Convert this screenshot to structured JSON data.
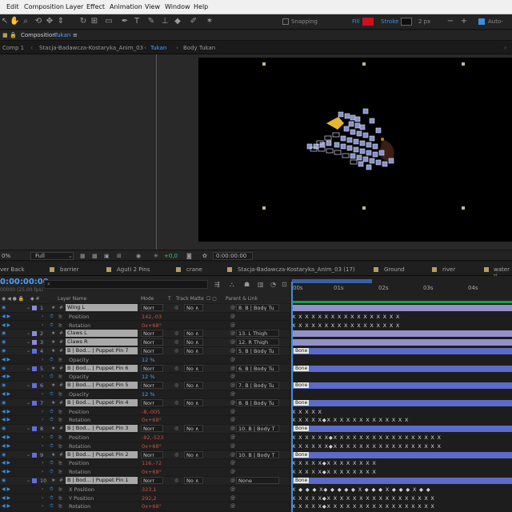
{
  "menu": [
    "Edit",
    "Composition",
    "Layer",
    "Effect",
    "Animation",
    "View",
    "Window",
    "Help"
  ],
  "toolbar": {
    "snapping": "Snapping",
    "fill": "Fill",
    "stroke": "Stroke",
    "stroke_width": "2 px",
    "auto": "Auto-",
    "fill_color": "#d1101f",
    "stroke_color": "#0e0e0e"
  },
  "comp_panel": {
    "prefix": "Composition",
    "name": "Tukan",
    "menu_glyph": "≡"
  },
  "breadcrumbs": [
    "Comp 1",
    "Stacja-Badawcza-Kostaryka_Anim_03",
    "Tukan",
    "Body Tukan"
  ],
  "viewer_footer": {
    "zoom": "0%",
    "resolution": "Full",
    "exposure": "+0,0",
    "timecode": "0:00:00:00"
  },
  "timeline_tabs": [
    "ver Back",
    "barrier",
    "Aguti 2 Pins",
    "crane",
    "Stacja-Badawcza-Kostaryka_Anim_03 (17)",
    "Ground",
    "river",
    "water ri"
  ],
  "timeline": {
    "timecode": "0:00:00:00",
    "fps": "00000 (25.00 fps)",
    "search_placeholder": "",
    "columns": {
      "layer_name": "Layer Name",
      "mode": "Mode",
      "t": "T",
      "track_matte": "Track Matte",
      "parent": "Parent & Link"
    },
    "ruler": [
      "00s",
      "01s",
      "02s",
      "03s",
      "04s"
    ]
  },
  "rows": [
    {
      "type": "layer",
      "num": "1",
      "name": "Wing L",
      "mode": "Norr",
      "tm": "No ∧",
      "parent": "8. B | Body Tu",
      "label": "#8f8ad9",
      "bar": "#9292c8",
      "kf": ""
    },
    {
      "type": "prop",
      "name": "Position",
      "value": "142,-03",
      "kf": "X                                X  X  X  X  X            X  X X X X X X X   X X X"
    },
    {
      "type": "prop",
      "name": "Rotation",
      "value": "0x+68°",
      "kf": "X                                X  X  X  X  X            X  X X X X X X X   X X X"
    },
    {
      "type": "layer",
      "num": "2",
      "name": "Claws L",
      "mode": "Norr",
      "tm": "No ∧",
      "parent": "13. L Thigh",
      "label": "#8f8ad9",
      "bar": "#9292c8",
      "kf": ""
    },
    {
      "type": "layer",
      "num": "3",
      "name": "Claws R",
      "mode": "Norr",
      "tm": "No ∧",
      "parent": "12. R Thigh",
      "label": "#8f8ad9",
      "bar": "#9292c8",
      "kf": ""
    },
    {
      "type": "layer",
      "num": "4",
      "name": "B | Bod... | Puppet Pin 7",
      "mode": "Norr",
      "tm": "No ∧",
      "parent": "5. B | Body Tu",
      "label": "#5f6ee0",
      "bar": "#5c6ac8",
      "kf": "",
      "bone": "Bone"
    },
    {
      "type": "prop",
      "name": "Opacity",
      "value": "12 %",
      "blue": true,
      "kf": ""
    },
    {
      "type": "layer",
      "num": "5",
      "name": "B | Bod... | Puppet Pin 6",
      "mode": "Norr",
      "tm": "No ∧",
      "parent": "6. B | Body Tu",
      "label": "#5f6ee0",
      "bar": "#5c6ac8",
      "kf": "",
      "bone": "Bone"
    },
    {
      "type": "prop",
      "name": "Opacity",
      "value": "12 %",
      "blue": true,
      "kf": ""
    },
    {
      "type": "layer",
      "num": "6",
      "name": "B | Bod... | Puppet Pin 5",
      "mode": "Norr",
      "tm": "No ∧",
      "parent": "7. B | Body Tu",
      "label": "#5f6ee0",
      "bar": "#5c6ac8",
      "kf": "",
      "bone": "Bone"
    },
    {
      "type": "prop",
      "name": "Opacity",
      "value": "12 %",
      "blue": true,
      "kf": ""
    },
    {
      "type": "layer",
      "num": "7",
      "name": "B | Bod... | Puppet Pin 4",
      "mode": "Norr",
      "tm": "No ∧",
      "parent": "8. B | Body Tu",
      "label": "#5f6ee0",
      "bar": "#5c6ac8",
      "kf": "",
      "bone": "Bone"
    },
    {
      "type": "prop",
      "name": "Position",
      "value": "-8,-005",
      "kf": "X                                                                    X       X       X       X"
    },
    {
      "type": "prop",
      "name": "Rotation",
      "value": "0x+68°",
      "kf": "X   X   X   X   X◆X  X  X   X  X  X  X  X  X     X       X       X       X"
    },
    {
      "type": "layer",
      "num": "8",
      "name": "B | Bod... | Puppet Pin 3",
      "mode": "Norr",
      "tm": "No ∧",
      "parent": "10. B | Body T",
      "label": "#5f6ee0",
      "bar": "#5c6ac8",
      "kf": "",
      "bone": "Bone"
    },
    {
      "type": "prop",
      "name": "Position",
      "value": "-92,-523",
      "kf": "X  X  X  X  X  X◆X  X  X  X  X  X  X  X  X  X  X  X  X  X  X  X  X"
    },
    {
      "type": "prop",
      "name": "Rotation",
      "value": "0x+68°",
      "kf": "X  X  X  X  X  X◆X  X  X  X  X  X  X  X  X  X  X  X  X  X  X  X  X"
    },
    {
      "type": "layer",
      "num": "9",
      "name": "B | Bod... | Puppet Pin 2",
      "mode": "Norr",
      "tm": "No ∧",
      "parent": "10. B | Body T",
      "label": "#5f6ee0",
      "bar": "#5c6ac8",
      "kf": "",
      "bone": "Bone"
    },
    {
      "type": "prop",
      "name": "Position",
      "value": "116,-72",
      "kf": "X   X   X   X   X◆X  X   X    X     X       X       X       X"
    },
    {
      "type": "prop",
      "name": "Rotation",
      "value": "0x+68°",
      "kf": "X   X   X   X   X◆X  X   X    X     X       X       X       X"
    },
    {
      "type": "layer",
      "num": "10",
      "name": "B | Bod... | Puppet Pin 1",
      "mode": "Norr",
      "tm": "No ∧",
      "parent": "None",
      "label": "#5f6ee0",
      "bar": "#5c6ac8",
      "kf": "",
      "bone": "Bone"
    },
    {
      "type": "prop",
      "name": "X Position",
      "value": "323,1",
      "kf": "X  ◆  ◆  ◆  X◆  ◆  ◆  ◆  ◆  X  ◆  ◆  ◆  X  ◆  ◆  ◆  X  ◆  ◆"
    },
    {
      "type": "prop",
      "name": "Y Position",
      "value": "292,2",
      "kf": "X  X  X  X  X◆X  X  X  X  X  X  X  X  X  X  X  X  X  X  X  X  X"
    },
    {
      "type": "prop",
      "name": "Rotation",
      "value": "0x+68°",
      "kf": "X  X  X  X  X◆X  X  X  X  X  X  X  X  X  X  X  X  X  X  X  X  X"
    }
  ]
}
